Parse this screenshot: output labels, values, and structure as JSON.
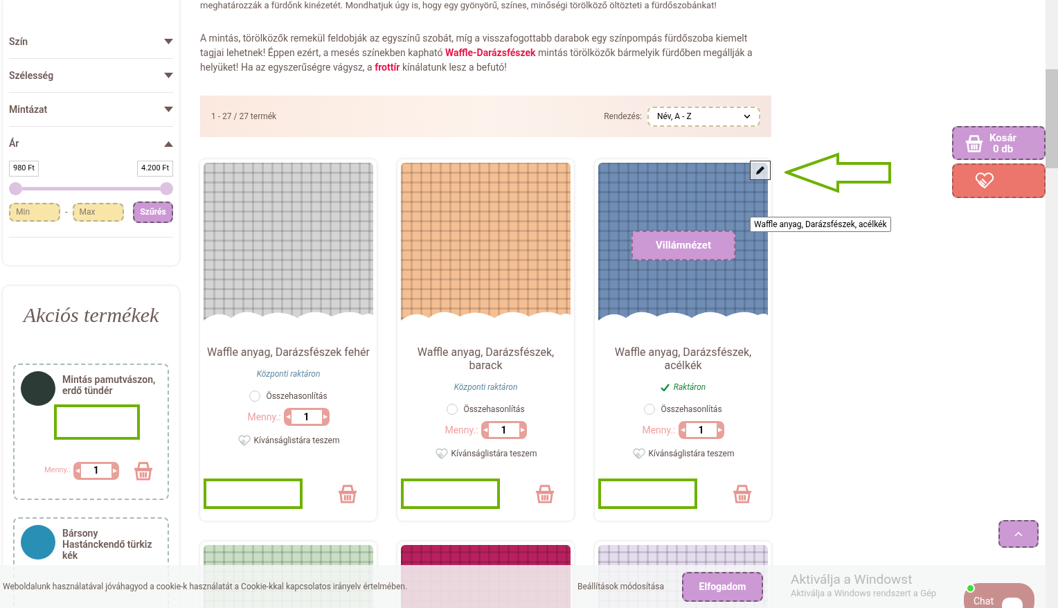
{
  "intro": {
    "cut_line": "meghatározzák a fürdőnk kinézetét. Mondhatjuk úgy is, hogy egy gyönyörű, színes, minőségi törölköző öltözteti a fürdőszobánkat!",
    "paragraph": "A mintás, törölközők remekül feldobják az egyszínű szobát, míg a visszafogottabb darabok egy színpompás fürdőszoba kiemelt tagjai lehetnek! Éppen ezért, a mesés színekben kapható **Waffle-Darázsfészek** mintás törölközők bármelyik fürdőben megállják a helyüket! Ha az egyszerűségre vágysz, a **frottír** kínálatunk lesz a befutó!"
  },
  "filters": [
    {
      "label": "Szín",
      "expanded": false
    },
    {
      "label": "Szélesség",
      "expanded": false
    },
    {
      "label": "Mintázat",
      "expanded": false
    },
    {
      "label": "Ár",
      "expanded": true
    }
  ],
  "price": {
    "min_value": "980 Ft",
    "max_value": "4.200 Ft",
    "low": {
      "level": 0
    },
    "high": {
      "level": 1
    },
    "min_placeholder": "Min",
    "separator": "-",
    "max_placeholder": "Max",
    "button": "Szűrés"
  },
  "sale": {
    "title": "Akciós termékek",
    "items": [
      {
        "name": "Mintás pamutvászon, erdő tündér",
        "qty_label": "Menny.:",
        "qty": "1",
        "dec": "◀",
        "inc": "▶"
      },
      {
        "name": "Bársony Hastánckendő türkiz kék"
      }
    ]
  },
  "listing": {
    "count": "1 - 27 / 27 termék",
    "sort_label": "Rendezés:",
    "sort_value": "Név, A - Z"
  },
  "products": [
    {
      "name": "Waffle anyag, Darázsfészek fehér",
      "color": "#d4d4d4",
      "stock": {
        "kind": "central",
        "text": "Központi raktáron"
      },
      "compare": {
        "label": "Összehasonlítás",
        "checked": false
      },
      "qty_label": "Menny.:",
      "qty": "1",
      "wishlist": "Kívánságlistára teszem",
      "dec": "◀",
      "inc": "▶",
      "hovered": false
    },
    {
      "name": "Waffle anyag, Darázsfészek, barack",
      "color": "#f5bf94",
      "stock": {
        "kind": "central",
        "text": "Központi raktáron"
      },
      "compare": {
        "label": "Összehasonlítás",
        "checked": false
      },
      "qty_label": "Menny.:",
      "qty": "1",
      "wishlist": "Kívánságlistára teszem",
      "dec": "◀",
      "inc": "▶",
      "hovered": false
    },
    {
      "name": "Waffle anyag, Darázsfészek, acélkék",
      "color": "#6f8db5",
      "stock": {
        "kind": "in_stock",
        "text": "Raktáron"
      },
      "compare": {
        "label": "Összehasonlítás",
        "checked": false
      },
      "qty_label": "Menny.:",
      "qty": "1",
      "wishlist": "Kívánságlistára teszem",
      "dec": "◀",
      "inc": "▶",
      "hovered": true,
      "quick_view": "Villámnézet",
      "tooltip": "Waffle anyag, Darázsfészek, acélkék"
    }
  ],
  "more_products": [
    {
      "color": "#c9dfc4"
    },
    {
      "color": "#b8215e"
    },
    {
      "color": "#e6dcef"
    }
  ],
  "cart": {
    "title": "Kosár",
    "count": "0 db"
  },
  "cookie": {
    "text": "Weboldalunk használatával jóváhagyod a cookie-k használatát a Cookie-kkal kapcsolatos irányelv értelmében.",
    "settings": "Beállítások módosítása",
    "accept": "Elfogadom"
  },
  "windows": {
    "title": "Aktiválja a Windowst",
    "subtitle": "Aktiválja a Windows rendszert a Gép"
  },
  "chat": {
    "label": "Chat",
    "online": true
  }
}
